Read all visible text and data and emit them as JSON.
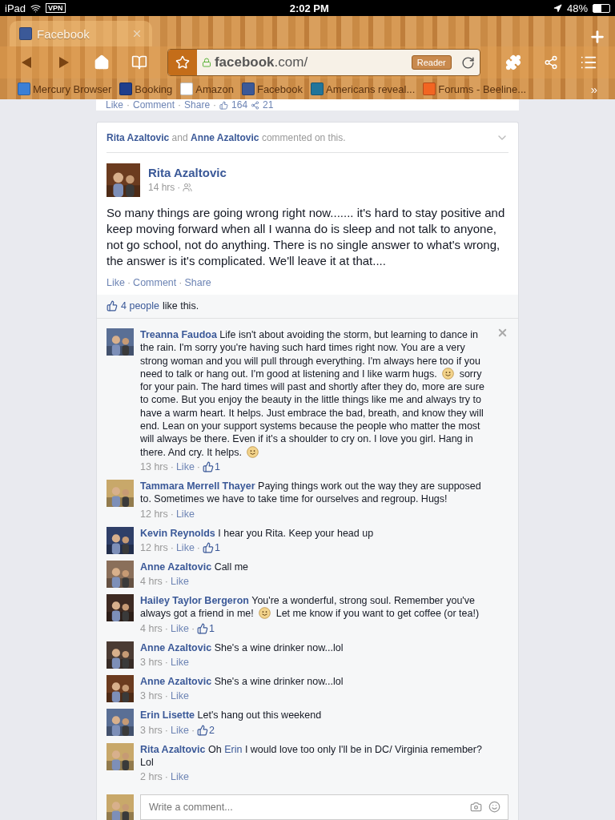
{
  "status_bar": {
    "device": "iPad",
    "vpn": "VPN",
    "time": "2:02 PM",
    "battery": "48%"
  },
  "browser": {
    "tabs": [
      {
        "title": "Facebook",
        "selected": true
      }
    ],
    "address": "**facebook**.com/",
    "reader": "Reader",
    "bookmarks": [
      {
        "label": "Mercury Browser",
        "color": "#3b7fd6"
      },
      {
        "label": "Booking",
        "color": "#1f3e8c"
      },
      {
        "label": "Amazon",
        "color": "#ffffff"
      },
      {
        "label": "Facebook",
        "color": "#3b5998"
      },
      {
        "label": "Americans reveal...",
        "color": "#21759b"
      },
      {
        "label": "Forums - Beeline...",
        "color": "#f26522"
      }
    ],
    "more": "»"
  },
  "sep": "·",
  "previous_story": {
    "actions": [
      "Like",
      "Comment",
      "Share"
    ],
    "likes": "164",
    "shares": "21"
  },
  "story": {
    "header": {
      "names": [
        "Rita Azaltovic",
        "Anne Azaltovic"
      ],
      "joiner": "and",
      "suffix": "commented on this."
    },
    "post": {
      "author": "Rita Azaltovic",
      "time": "14 hrs",
      "text": "So many things are going wrong right now....... it's hard to stay positive and keep moving forward when all I wanna do is sleep and not talk to anyone, not go school, not do anything. There is no single answer to what's wrong, the answer is it's complicated. We'll leave it at that....",
      "actions": [
        "Like",
        "Comment",
        "Share"
      ]
    },
    "likes": {
      "count": "4 people",
      "suffix": "like this."
    },
    "comments": [
      {
        "author": "Treanna Faudoa",
        "parts": [
          {
            "kind": "text",
            "text": "Life isn't about avoiding the storm, but learning to dance in the rain. I'm sorry you're having such hard times right now. You are a very strong woman and you will pull through everything. I'm always here too if you need to talk or hang out. I'm good at listening and I like warm hugs."
          },
          {
            "kind": "smiley"
          },
          {
            "kind": "text",
            "text": "sorry for your pain. The hard times will past and shortly after they do, more are sure to come. But you enjoy the beauty in the little things like me and always try to have a warm heart. It helps. Just embrace the bad, breath, and know they will end. Lean on your support systems because the people who matter the most will always be there. Even if it's a shoulder to cry on. I love you girl. Hang in there. And cry. It helps."
          },
          {
            "kind": "smiley"
          }
        ],
        "time": "13 hrs",
        "action": "Like",
        "likes": "1",
        "removable": true
      },
      {
        "author": "Tammara Merrell Thayer",
        "parts": [
          {
            "kind": "text",
            "text": "Paying things work out the way they are supposed to. Sometimes we have to take time for ourselves and regroup. Hugs!"
          }
        ],
        "time": "12 hrs",
        "action": "Like",
        "removable": false
      },
      {
        "author": "Kevin Reynolds",
        "parts": [
          {
            "kind": "text",
            "text": "I hear you Rita. Keep your head up"
          }
        ],
        "time": "12 hrs",
        "action": "Like",
        "likes": "1",
        "removable": false
      },
      {
        "author": "Anne Azaltovic",
        "parts": [
          {
            "kind": "text",
            "text": "Call me"
          }
        ],
        "time": "4 hrs",
        "action": "Like",
        "removable": false
      },
      {
        "author": "Hailey Taylor Bergeron",
        "parts": [
          {
            "kind": "text",
            "text": "You're a wonderful, strong soul. Remember you've always got a friend in me!"
          },
          {
            "kind": "smiley"
          },
          {
            "kind": "text",
            "text": "Let me know if you want to get coffee (or tea!)"
          }
        ],
        "time": "4 hrs",
        "action": "Like",
        "likes": "1",
        "removable": false
      },
      {
        "author": "Anne Azaltovic",
        "parts": [
          {
            "kind": "text",
            "text": "She's a wine drinker now...lol"
          }
        ],
        "time": "3 hrs",
        "action": "Like",
        "removable": false
      },
      {
        "author": "Anne Azaltovic",
        "parts": [
          {
            "kind": "text",
            "text": "She's a wine drinker now...lol"
          }
        ],
        "time": "3 hrs",
        "action": "Like",
        "removable": false
      },
      {
        "author": "Erin Lisette",
        "parts": [
          {
            "kind": "text",
            "text": "Let's hang out this weekend"
          }
        ],
        "time": "3 hrs",
        "action": "Like",
        "likes": "2",
        "removable": false
      },
      {
        "author": "Rita Azaltovic",
        "parts": [
          {
            "kind": "text",
            "text": "Oh"
          },
          {
            "kind": "mention",
            "text": "Erin"
          },
          {
            "kind": "text",
            "text": "I would love too only I'll be in DC/ Virginia remember? Lol"
          }
        ],
        "time": "2 hrs",
        "action": "Like",
        "removable": false
      }
    ],
    "composer": {
      "placeholder": "Write a comment..."
    }
  }
}
